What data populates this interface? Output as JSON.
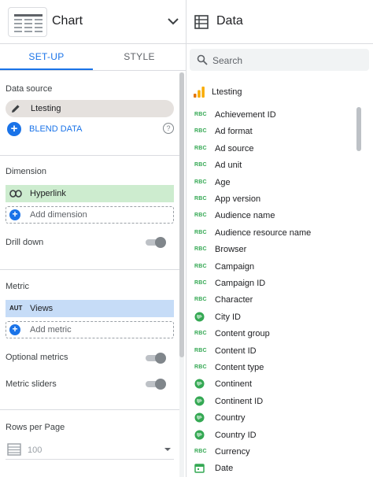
{
  "chart_header": {
    "title": "Chart"
  },
  "data_header": {
    "title": "Data"
  },
  "tabs": [
    {
      "label": "SET-UP",
      "active": true
    },
    {
      "label": "STYLE",
      "active": false
    }
  ],
  "setup": {
    "data_source_label": "Data source",
    "data_source_name": "Ltesting",
    "blend_label": "BLEND DATA",
    "help_symbol": "?",
    "dimension_label": "Dimension",
    "dimension_field": "Hyperlink",
    "add_dimension": "Add dimension",
    "drill_down_label": "Drill down",
    "metric_label": "Metric",
    "metric_aggregation": "AUT",
    "metric_field": "Views",
    "add_metric": "Add metric",
    "optional_metrics_label": "Optional metrics",
    "metric_sliders_label": "Metric sliders",
    "rows_per_page_label": "Rows per Page",
    "rows_per_page_value": "100",
    "toggles": {
      "drill_down": false,
      "optional_metrics": false,
      "metric_sliders": false
    }
  },
  "data_panel": {
    "search_placeholder": "Search",
    "source_name": "Ltesting",
    "fields": [
      {
        "name": "Achievement ID",
        "type": "RBC"
      },
      {
        "name": "Ad format",
        "type": "RBC"
      },
      {
        "name": "Ad source",
        "type": "RBC"
      },
      {
        "name": "Ad unit",
        "type": "RBC"
      },
      {
        "name": "Age",
        "type": "RBC"
      },
      {
        "name": "App version",
        "type": "RBC"
      },
      {
        "name": "Audience name",
        "type": "RBC"
      },
      {
        "name": "Audience resource name",
        "type": "RBC"
      },
      {
        "name": "Browser",
        "type": "RBC"
      },
      {
        "name": "Campaign",
        "type": "RBC"
      },
      {
        "name": "Campaign ID",
        "type": "RBC"
      },
      {
        "name": "Character",
        "type": "RBC"
      },
      {
        "name": "City ID",
        "type": "geo"
      },
      {
        "name": "Content group",
        "type": "RBC"
      },
      {
        "name": "Content ID",
        "type": "RBC"
      },
      {
        "name": "Content type",
        "type": "RBC"
      },
      {
        "name": "Continent",
        "type": "geo"
      },
      {
        "name": "Continent ID",
        "type": "geo"
      },
      {
        "name": "Country",
        "type": "geo"
      },
      {
        "name": "Country ID",
        "type": "geo"
      },
      {
        "name": "Currency",
        "type": "RBC"
      },
      {
        "name": "Date",
        "type": "date"
      }
    ]
  },
  "colors": {
    "accent": "#1a73e8",
    "dimension_chip": "#cdeccf",
    "metric_chip": "#c6dcf7",
    "source_chip": "#e5e1de",
    "text_field_type": "#34a853"
  }
}
